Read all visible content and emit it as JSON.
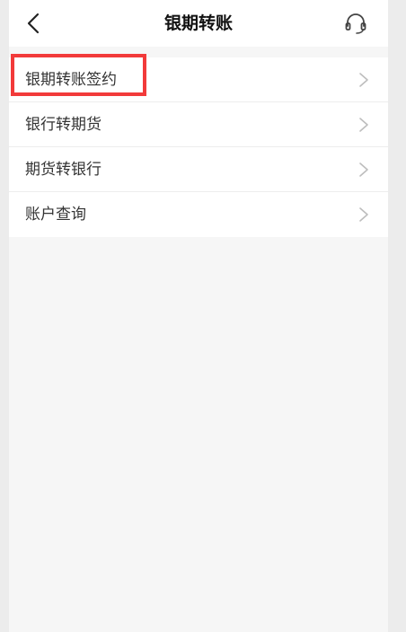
{
  "header": {
    "title": "银期转账",
    "back_icon": "chevron-left-icon",
    "support_icon": "headset-icon"
  },
  "menu": {
    "items": [
      {
        "label": "银期转账签约"
      },
      {
        "label": "银行转期货"
      },
      {
        "label": "期货转银行"
      },
      {
        "label": "账户查询"
      }
    ],
    "chevron_icon": "chevron-right-icon"
  },
  "colors": {
    "highlight": "#f23a3a",
    "background": "#f6f6f6",
    "surface": "#ffffff"
  }
}
